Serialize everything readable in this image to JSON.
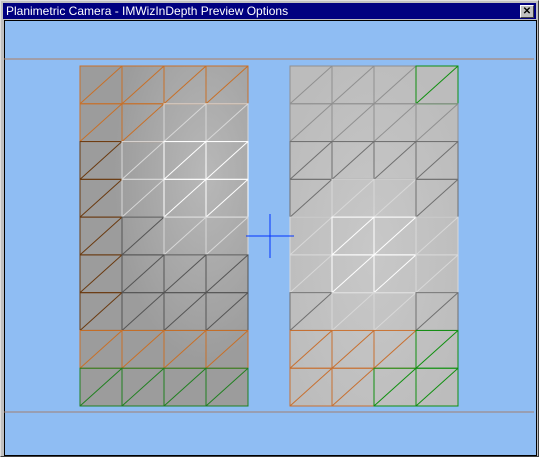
{
  "window": {
    "title": "Planimetric Camera - IMWizInDepth Preview Options",
    "close_icon": "close-x-icon"
  },
  "preview": {
    "grid_columns": 4,
    "grid_rows": 9,
    "left_panel_fill": "#a0a0a0",
    "right_panel_fill": "#c0c0c0",
    "crosshair_color": "#0033ff",
    "background": "#8fbdf3"
  }
}
